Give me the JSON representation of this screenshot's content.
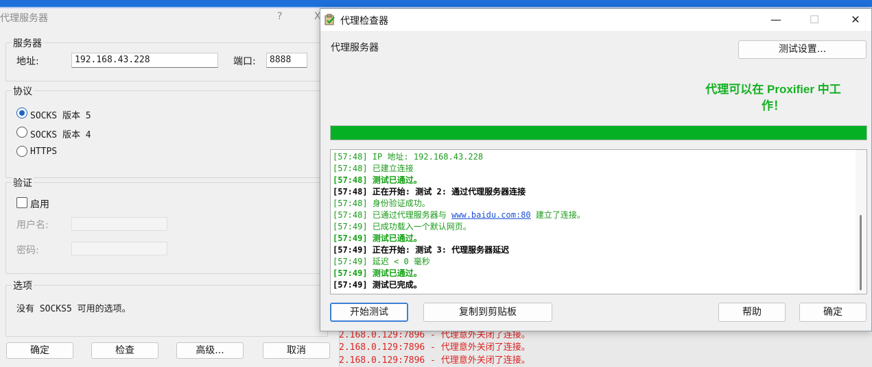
{
  "background_dialog": {
    "title": "代理服务器",
    "help_glyph": "?",
    "close_glyph": "X",
    "server_group": {
      "title": "服务器",
      "address_label": "地址:",
      "address_value": "192.168.43.228",
      "port_label": "端口:",
      "port_value": "8888"
    },
    "protocol_group": {
      "title": "协议",
      "options": [
        "SOCKS 版本 5",
        "SOCKS 版本 4",
        "HTTPS"
      ],
      "selected": "SOCKS 版本 5"
    },
    "auth_group": {
      "title": "验证",
      "enable_label": "启用",
      "enabled": false,
      "username_label": "用户名:",
      "password_label": "密码:"
    },
    "options_group": {
      "title": "选项",
      "text": "没有 SOCKS5 可用的选项。"
    },
    "buttons": {
      "ok": "确定",
      "check": "检查",
      "advanced": "高级...",
      "cancel": "取消"
    },
    "underlying_log": [
      "2.168.0.129:7896 - 代理意外关闭了连接。",
      "2.168.0.129:7896 - 代理意外关闭了连接。",
      "2.168.0.129:7896 - 代理意外关闭了连接。"
    ]
  },
  "checker_window": {
    "title": "代理检查器",
    "controls": {
      "minimize": "—",
      "maximize": "☐",
      "close": "✕"
    },
    "section_label": "代理服务器",
    "settings_button": "测试设置...",
    "result_line1": "代理可以在 Proxifier 中工",
    "result_line2": "作！",
    "progress_percent": 100,
    "colors": {
      "progress": "#06b025",
      "success_text": "#13b022"
    },
    "log": {
      "l0": "[57:48] IP 地址: 192.168.43.228",
      "l1": "[57:48] 已建立连接",
      "l2": "[57:48] 测试已通过。",
      "l3": "[57:48] 正在开始: 测试 2: 通过代理服务器连接",
      "l4": "[57:48] 身份验证成功。",
      "l5_pre": "[57:48] 已通过代理服务器与 ",
      "l5_link": "www.baidu.com:80",
      "l5_post": " 建立了连接。",
      "l6": "[57:49] 已成功载入一个默认网页。",
      "l7": "[57:49] 测试已通过。",
      "l8": "[57:49] 正在开始: 测试 3: 代理服务器延迟",
      "l9": "[57:49] 延迟 < 0 毫秒",
      "l10": "[57:49] 测试已通过。",
      "l11": "[57:49] 测试已完成。"
    },
    "buttons": {
      "start_test": "开始测试",
      "copy_clipboard": "复制到剪贴板",
      "help": "帮助",
      "ok": "确定"
    }
  }
}
